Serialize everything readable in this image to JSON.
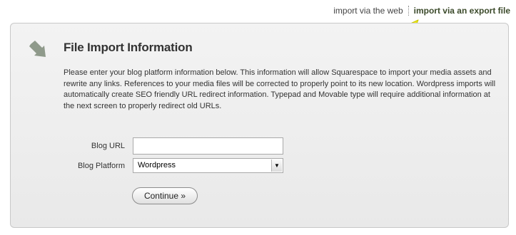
{
  "nav": {
    "links": [
      {
        "label": "import via the web"
      },
      {
        "label": "import via an export file"
      }
    ],
    "active_index": 1
  },
  "panel": {
    "icon": "import-arrow-icon",
    "title": "File Import Information",
    "description": "Please enter your blog platform information below. This information will allow Squarespace to import your media assets and rewrite any links. References to your media files will be corrected to properly point to its new location. Wordpress imports will automatically create SEO friendly URL redirect information. Typepad and Movable type will require additional information at the next screen to properly redirect old URLs."
  },
  "form": {
    "blog_url": {
      "label": "Blog URL",
      "value": ""
    },
    "blog_platform": {
      "label": "Blog Platform",
      "selected": "Wordpress"
    },
    "continue_label": "Continue »"
  },
  "colors": {
    "annotation_arrow": "#f2ee1c",
    "icon_gray": "#8f9a8b",
    "active_link": "#3b4a2a"
  }
}
